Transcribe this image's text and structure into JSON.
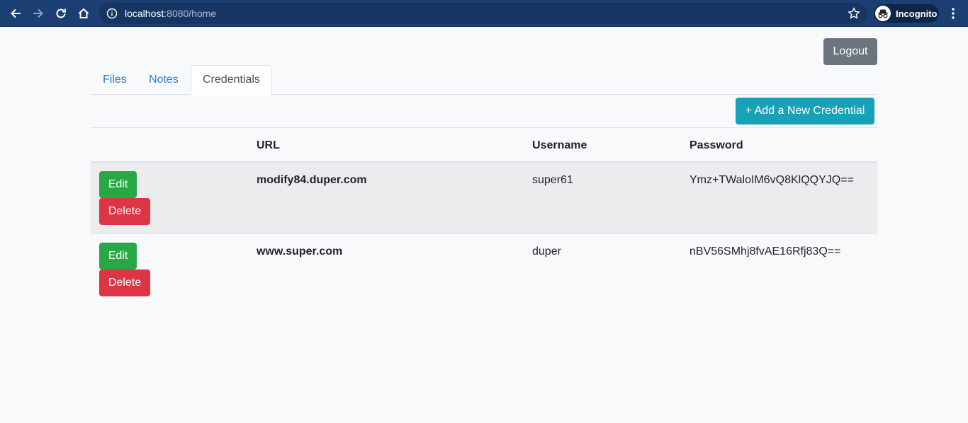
{
  "browser": {
    "url_host": "localhost",
    "url_rest": ":8080/home",
    "profile_label": "Incognito"
  },
  "page": {
    "logout_label": "Logout",
    "tabs": [
      {
        "label": "Files",
        "active": false
      },
      {
        "label": "Notes",
        "active": false
      },
      {
        "label": "Credentials",
        "active": true
      }
    ],
    "add_credential_label": "+ Add a New Credential",
    "table": {
      "headers": [
        "",
        "URL",
        "Username",
        "Password"
      ],
      "rows": [
        {
          "url": "modify84.duper.com",
          "username": "super61",
          "password": "Ymz+TWaloIM6vQ8KlQQYJQ==",
          "edit_label": "Edit",
          "delete_label": "Delete"
        },
        {
          "url": "www.super.com",
          "username": "duper",
          "password": "nBV56SMhj8fvAE16Rfj83Q==",
          "edit_label": "Edit",
          "delete_label": "Delete"
        }
      ]
    }
  },
  "colors": {
    "chrome_bg": "#1c3f73",
    "logout_bg": "#6c757d",
    "add_bg": "#17a2b8",
    "edit_bg": "#28a745",
    "delete_bg": "#dc3545",
    "link": "#2a7bd1"
  }
}
